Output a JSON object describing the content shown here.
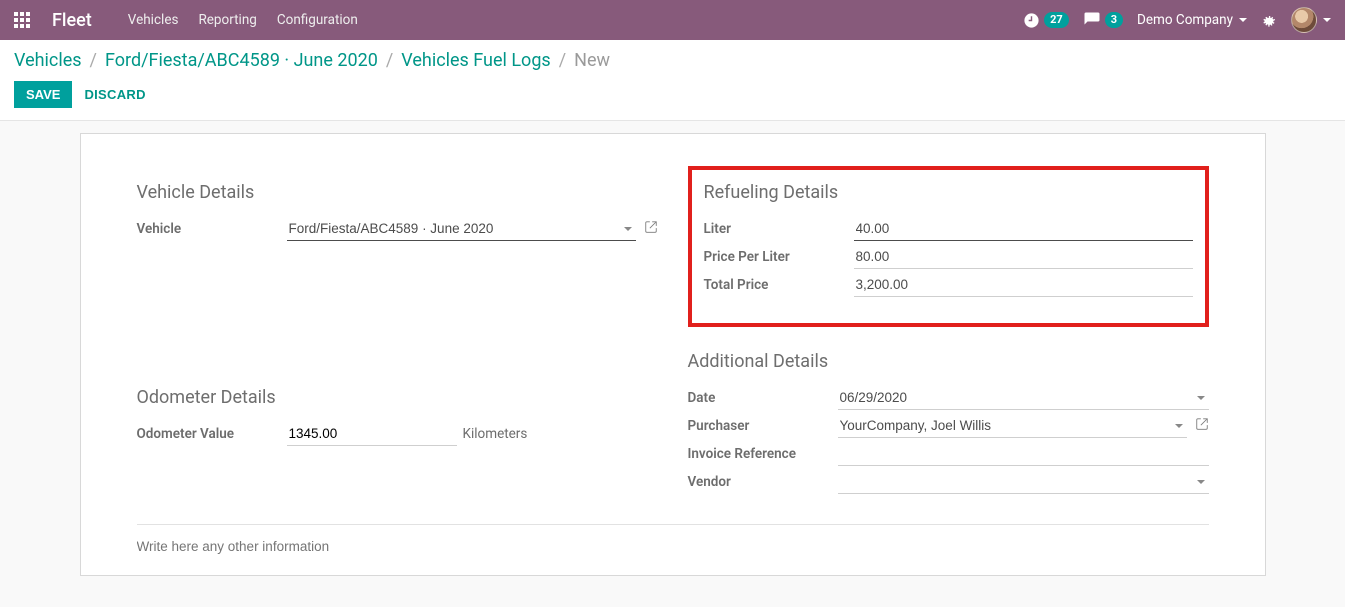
{
  "top": {
    "brand": "Fleet",
    "nav": [
      "Vehicles",
      "Reporting",
      "Configuration"
    ],
    "badge_clock": "27",
    "badge_chat": "3",
    "company": "Demo Company"
  },
  "breadcrumbs": {
    "items": [
      "Vehicles",
      "Ford/Fiesta/ABC4589 · June 2020",
      "Vehicles Fuel Logs"
    ],
    "current": "New"
  },
  "actions": {
    "save": "SAVE",
    "discard": "DISCARD"
  },
  "sections": {
    "vehicle_details": "Vehicle Details",
    "refueling_details": "Refueling Details",
    "odometer_details": "Odometer Details",
    "additional_details": "Additional Details"
  },
  "vehicle": {
    "label": "Vehicle",
    "value": "Ford/Fiesta/ABC4589 · June 2020"
  },
  "refueling": {
    "liter_label": "Liter",
    "liter_value": "40.00",
    "ppl_label": "Price Per Liter",
    "ppl_value": "80.00",
    "total_label": "Total Price",
    "total_value": "3,200.00"
  },
  "odometer": {
    "label": "Odometer Value",
    "value": "1345.00",
    "unit": "Kilometers"
  },
  "additional": {
    "date_label": "Date",
    "date_value": "06/29/2020",
    "purchaser_label": "Purchaser",
    "purchaser_value": "YourCompany, Joel Willis",
    "invoice_ref_label": "Invoice Reference",
    "invoice_ref_value": "",
    "vendor_label": "Vendor",
    "vendor_value": ""
  },
  "notes_placeholder": "Write here any other information"
}
